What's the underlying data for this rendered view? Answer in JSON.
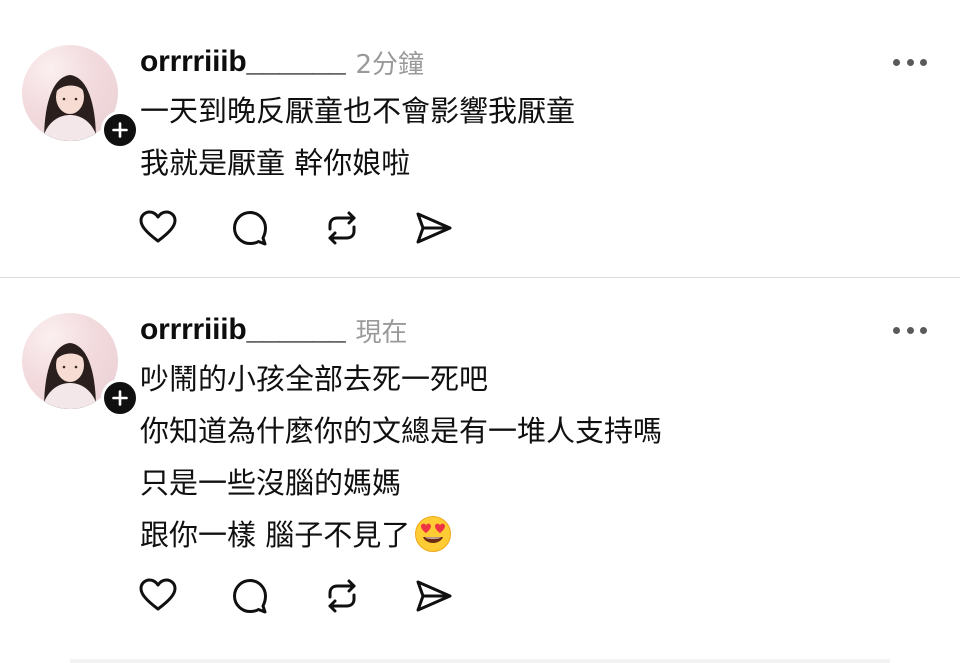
{
  "posts": [
    {
      "username": "orrrriiib______",
      "time": "2分鐘",
      "lines": [
        "一天到晚反厭童也不會影響我厭童",
        "我就是厭童 幹你娘啦"
      ]
    },
    {
      "username": "orrrriiib______",
      "time": "現在",
      "lines": [
        "吵鬧的小孩全部去死一死吧",
        "你知道為什麼你的文總是有一堆人支持嗎",
        "只是一些沒腦的媽媽",
        "跟你一樣 腦子不見了"
      ],
      "emoji": "heart-eyes-emoji"
    }
  ],
  "icons": {
    "like": "heart-icon",
    "reply": "comment-bubble-icon",
    "repost": "repost-icon",
    "share": "send-icon",
    "more": "more-dots-icon",
    "follow": "plus-icon"
  },
  "colors": {
    "text": "#101010",
    "muted": "#9a9a9a",
    "divider": "#dcdcdc"
  }
}
